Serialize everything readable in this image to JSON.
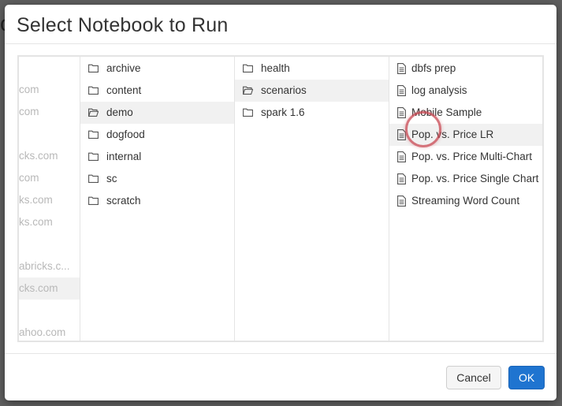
{
  "dialog": {
    "title": "Select Notebook to Run",
    "cancel_label": "Cancel",
    "ok_label": "OK"
  },
  "columns": {
    "users": [
      {
        "label": "",
        "selected": false
      },
      {
        "label": "com",
        "selected": false
      },
      {
        "label": "com",
        "selected": false
      },
      {
        "label": "",
        "selected": false
      },
      {
        "label": "cks.com",
        "selected": false
      },
      {
        "label": "com",
        "selected": false
      },
      {
        "label": "ks.com",
        "selected": false
      },
      {
        "label": "ks.com",
        "selected": false
      },
      {
        "label": "",
        "selected": false
      },
      {
        "label": "abricks.c...",
        "selected": false
      },
      {
        "label": "cks.com",
        "selected": true
      },
      {
        "label": "",
        "selected": false
      },
      {
        "label": "ahoo.com",
        "selected": false
      }
    ],
    "folders": [
      {
        "label": "archive",
        "icon": "folder-icon",
        "selected": false
      },
      {
        "label": "content",
        "icon": "folder-icon",
        "selected": false
      },
      {
        "label": "demo",
        "icon": "folder-open-icon",
        "selected": true
      },
      {
        "label": "dogfood",
        "icon": "folder-icon",
        "selected": false
      },
      {
        "label": "internal",
        "icon": "folder-icon",
        "selected": false
      },
      {
        "label": "sc",
        "icon": "folder-icon",
        "selected": false
      },
      {
        "label": "scratch",
        "icon": "folder-icon",
        "selected": false
      }
    ],
    "subfolders": [
      {
        "label": "health",
        "icon": "folder-icon",
        "selected": false
      },
      {
        "label": "scenarios",
        "icon": "folder-open-icon",
        "selected": true
      },
      {
        "label": "spark 1.6",
        "icon": "folder-icon",
        "selected": false
      }
    ],
    "notebooks": [
      {
        "label": "dbfs prep",
        "icon": "notebook-icon",
        "selected": false
      },
      {
        "label": "log analysis",
        "icon": "notebook-icon",
        "selected": false
      },
      {
        "label": "Mobile Sample",
        "icon": "notebook-icon",
        "selected": false
      },
      {
        "label": "Pop. vs. Price LR",
        "icon": "notebook-icon",
        "selected": true
      },
      {
        "label": "Pop. vs. Price Multi-Chart",
        "icon": "notebook-icon",
        "selected": false
      },
      {
        "label": "Pop. vs. Price Single Chart",
        "icon": "notebook-icon",
        "selected": false
      },
      {
        "label": "Streaming Word Count",
        "icon": "notebook-icon",
        "selected": false
      }
    ]
  }
}
